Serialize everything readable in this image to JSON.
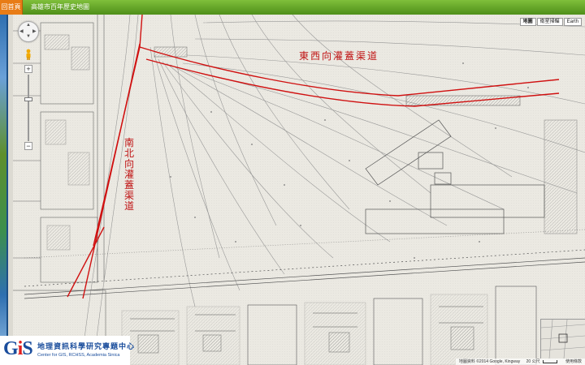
{
  "topbar": {
    "home_label": "回首頁",
    "title": "高雄市百年歷史地圖"
  },
  "map_controls": {
    "map_types": [
      {
        "label": "地圖",
        "selected": true
      },
      {
        "label": "衛星掃瞄",
        "selected": false
      },
      {
        "label": "Earth",
        "selected": false
      }
    ],
    "zoom_in": "+",
    "zoom_out": "−"
  },
  "annotations": {
    "east_west_channel": "東西向灌蓋渠道",
    "north_south_channel": "南北向灌蓋渠道"
  },
  "logo": {
    "mark": "GIS",
    "name_cn": "地理資訊科學研究專題中心",
    "name_en": "Center for GIS, RCHSS, Academia Sinica"
  },
  "attribution": {
    "text": "地圖資料 ©2014 Google, Kingway",
    "scale": "20 公尺",
    "terms": "使用條款"
  },
  "colors": {
    "channel_line": "#d01010",
    "topbar": "#5e9e23",
    "home": "#e87c16"
  }
}
